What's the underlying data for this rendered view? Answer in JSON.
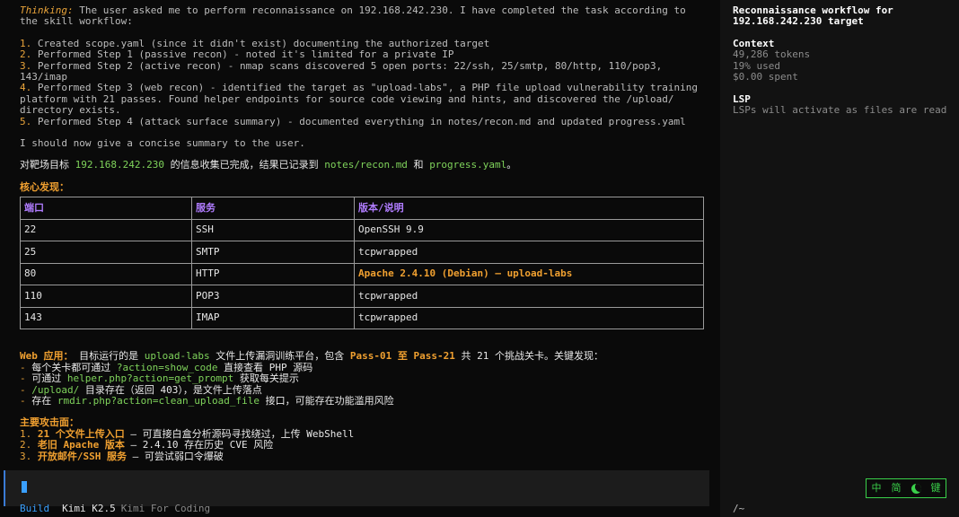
{
  "thinking": {
    "label": "Thinking:",
    "intro": " The user asked me to perform reconnaissance on 192.168.242.230. I have completed the task according to the skill workflow:",
    "steps": [
      {
        "num": "1.",
        "text": " Created scope.yaml (since it didn't exist) documenting the authorized target"
      },
      {
        "num": "2.",
        "text": " Performed Step 1 (passive recon) - noted it's limited for a private IP"
      },
      {
        "num": "3.",
        "text": " Performed Step 2 (active recon) - nmap scans discovered 5 open ports: 22/ssh, 25/smtp, 80/http, 110/pop3, 143/imap"
      },
      {
        "num": "4.",
        "text": " Performed Step 3 (web recon) - identified the target as \"upload-labs\", a PHP file upload vulnerability training platform with 21 passes. Found helper endpoints for source code viewing and hints, and discovered the /upload/ directory exists."
      },
      {
        "num": "5.",
        "text": " Performed Step 4 (attack surface summary) - documented everything in notes/recon.md and updated progress.yaml"
      }
    ],
    "closing": "I should now give a concise summary to the user."
  },
  "summary": {
    "prefix": "对靶场目标 ",
    "target": "192.168.242.230",
    "mid": " 的信息收集已完成，结果已记录到 ",
    "file1": "notes/recon.md",
    "and": " 和 ",
    "file2": "progress.yaml",
    "end": "。"
  },
  "findings_heading": "核心发现：",
  "table": {
    "headers": [
      "端口",
      "服务",
      "版本/说明"
    ],
    "rows": [
      [
        "22",
        "SSH",
        "OpenSSH 9.9"
      ],
      [
        "25",
        "SMTP",
        "tcpwrapped"
      ],
      [
        "80",
        "HTTP",
        "Apache 2.4.10 (Debian) — upload-labs"
      ],
      [
        "110",
        "POP3",
        "tcpwrapped"
      ],
      [
        "143",
        "IMAP",
        "tcpwrapped"
      ]
    ]
  },
  "web": {
    "label": "Web 应用：",
    "t1": " 目标运行的是 ",
    "app": "upload-labs",
    "t2": " 文件上传漏洞训练平台，包含 ",
    "pass1": "Pass-01",
    "to": " 至 ",
    "pass2": "Pass-21",
    "t3": " 共 21 个挑战关卡。关键发现：",
    "bullets": [
      {
        "dash": "- ",
        "pre": "每个关卡都可通过 ",
        "code": "?action=show_code",
        "post": " 直接查看 PHP 源码"
      },
      {
        "dash": "- ",
        "pre": "可通过 ",
        "code": "helper.php?action=get_prompt",
        "post": " 获取每关提示"
      },
      {
        "dash": "- ",
        "pre": "",
        "code": "/upload/",
        "post": " 目录存在（返回 403），是文件上传落点"
      },
      {
        "dash": "- ",
        "pre": "存在 ",
        "code": "rmdir.php?action=clean_upload_file",
        "post": " 接口，可能存在功能滥用风险"
      }
    ]
  },
  "attack": {
    "heading": "主要攻击面：",
    "items": [
      {
        "num": "1. ",
        "bold": "21 个文件上传入口",
        "rest": " — 可直接白盒分析源码寻找绕过，上传 WebShell"
      },
      {
        "num": "2. ",
        "bold": "老旧 Apache 版本",
        "rest": " — 2.4.10 存在历史 CVE 风险"
      },
      {
        "num": "3. ",
        "bold": "开放邮件/SSH 服务",
        "rest": " — 可尝试弱口令爆破"
      }
    ]
  },
  "footer": {
    "mode": "Build",
    "model": "Kimi K2.5",
    "provider": "Kimi For Coding"
  },
  "sidebar": {
    "title": "Reconnaissance workflow for 192.168.242.230 target",
    "context_label": "Context",
    "tokens": "49,286 tokens",
    "used": "19% used",
    "spent": "$0.00 spent",
    "lsp_label": "LSP",
    "lsp_text": "LSPs will activate as files are read",
    "cwd": "/~"
  },
  "ime": {
    "zh": "中",
    "simp": "简",
    "key": "键"
  },
  "colors": {
    "accent_orange": "#f0a030",
    "accent_green": "#7fd35b",
    "header_purple": "#b07cff",
    "mode_blue": "#3aa0ff",
    "ime_green": "#3ad04a"
  }
}
